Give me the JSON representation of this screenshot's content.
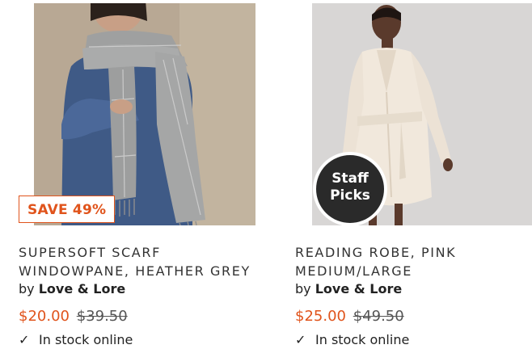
{
  "products": [
    {
      "title_lines": [
        "SUPERSOFT SCARF",
        "WINDOWPANE, HEATHER GREY"
      ],
      "brand_prefix": "by",
      "brand": "Love & Lore",
      "sale_price": "$20.00",
      "original_price": "$39.50",
      "badge": "SAVE 49%",
      "stock": "In stock online"
    },
    {
      "title_lines": [
        "READING ROBE, PINK",
        "MEDIUM/LARGE"
      ],
      "brand_prefix": "by",
      "brand": "Love & Lore",
      "sale_price": "$25.00",
      "original_price": "$49.50",
      "badge_lines": [
        "Staff",
        "Picks"
      ],
      "stock": "In stock online"
    }
  ],
  "colors": {
    "accent": "#e0541c",
    "badge_dark": "#2a2a2a"
  },
  "icons": {
    "stock": "checkmark-icon"
  }
}
